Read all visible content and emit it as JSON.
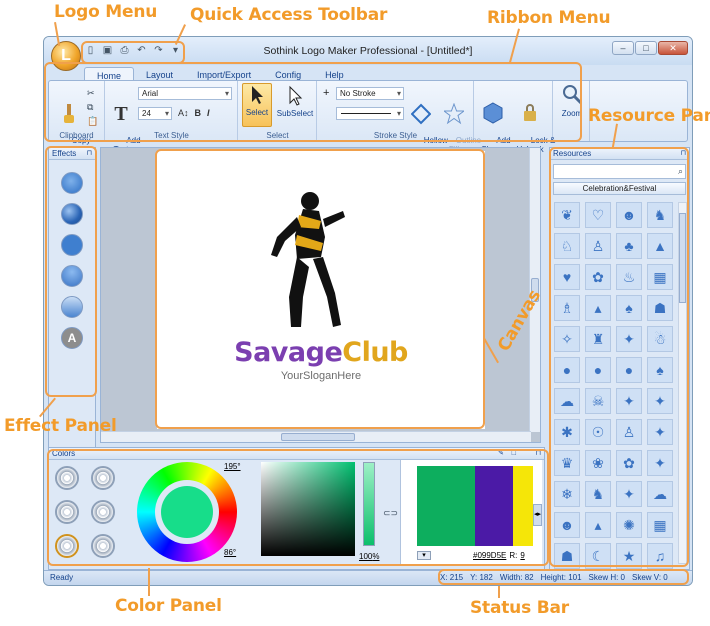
{
  "annotations": {
    "logo_menu": "Logo Menu",
    "quick_access": "Quick Access Toolbar",
    "ribbon_menu": "Ribbon Menu",
    "resource_panel": "Resource Panel",
    "effect_panel": "Effect Panel",
    "canvas": "Canvas",
    "color_panel": "Color Panel",
    "status_bar": "Status Bar"
  },
  "window": {
    "title": "Sothink Logo Maker Professional - [Untitled*]",
    "logo_letter": "L"
  },
  "tabs": [
    "Home",
    "Layout",
    "Import/Export",
    "Config",
    "Help"
  ],
  "ribbon": {
    "copy_format": "Copy\nFormat",
    "clipboard": "Clipboard",
    "add_text": "Add\nText",
    "font_name": "Arial",
    "font_size": "24",
    "text_style": "Text Style",
    "select": "Select",
    "subselect": "SubSelect",
    "select_group": "Select",
    "stroke": "No Stroke",
    "hollow": "Hollow",
    "outline_fill": "Outline\nFill",
    "stroke_style": "Stroke Style",
    "add_shape": "Add\nShape",
    "lock_unlock": "Lock &\nUnLock",
    "zoom": "Zoom"
  },
  "effects": {
    "title": "Effects",
    "letter": "A"
  },
  "canvas": {
    "brand_part1": "Savage",
    "brand_part2": "Club",
    "slogan": "YourSloganHere"
  },
  "resources": {
    "title": "Resources",
    "category": "Celebration&Festival"
  },
  "colors": {
    "title": "Colors",
    "hue_top": "195°",
    "hue_bottom": "86°",
    "percent": "100",
    "percent_unit": "%",
    "hex": "#099D5E",
    "r_label": "R:",
    "r_value": "9",
    "swatches": [
      "#0dae5e",
      "#4b1aa6",
      "#f5e608"
    ]
  },
  "status": {
    "ready": "Ready",
    "x": "X: 215",
    "y": "Y: 182",
    "width": "Width: 82",
    "height": "Height: 101",
    "skew_h": "Skew H: 0",
    "skew_v": "Skew V: 0"
  }
}
